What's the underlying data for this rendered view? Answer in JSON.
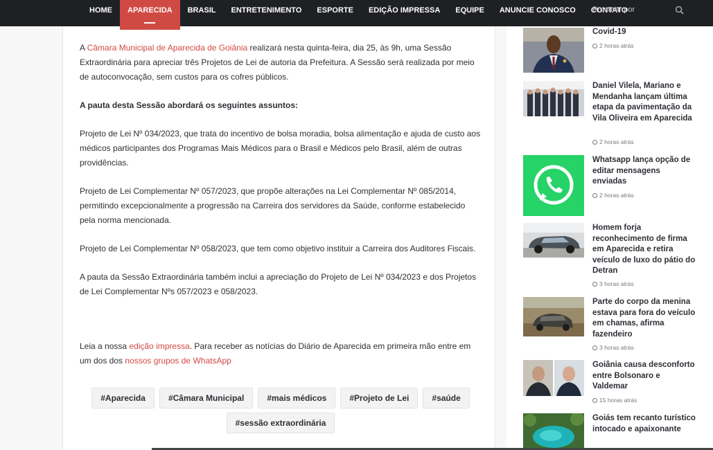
{
  "nav": {
    "items": [
      "HOME",
      "APARECIDA",
      "BRASIL",
      "ENTRETENIMENTO",
      "ESPORTE",
      "EDIÇÃO IMPRESSA",
      "EQUIPE",
      "ANUNCIE CONOSCO",
      "CONTATO"
    ],
    "active": "APARECIDA",
    "search_placeholder": "Procurar por"
  },
  "article": {
    "p1_prefix": "A ",
    "p1_link": "Câmara Municipal de Aparecida de Goiânia",
    "p1_rest": " realizará nesta quinta-feira, dia 25, às 9h, uma Sessão Extraordinária para apreciar três Projetos de Lei de autoria da Prefeitura. A Sessão será realizada por meio de autoconvocação, sem custos para os cofres públicos.",
    "heading": "A pauta desta Sessão abordará os seguintes assuntos:",
    "p2": "Projeto de Lei Nº 034/2023, que trata do incentivo de bolsa moradia, bolsa alimentação e ajuda de custo aos médicos participantes dos Programas Mais Médicos para o Brasil e Médicos pelo Brasil, além de outras providências.",
    "p3": "Projeto de Lei Complementar Nº 057/2023, que propõe alterações na Lei Complementar Nº 085/2014, permitindo excepcionalmente a progressão na Carreira dos servidores da Saúde, conforme estabelecido pela norma mencionada.",
    "p4": "Projeto de Lei Complementar Nº 058/2023, que tem como objetivo instituir a Carreira dos Auditores Fiscais.",
    "p5": "A pauta da Sessão Extraordinária também inclui a apreciação do Projeto de Lei Nº 034/2023 e dos Projetos de Lei Complementar Nºs 057/2023 e 058/2023.",
    "note_prefix": "Leia a nossa ",
    "note_link1": "edição impressa",
    "note_mid": ". Para receber as notícias do Diário de Aparecida em primeira mão entre em um dos dos ",
    "note_link2": "nossos grupos de WhatsApp"
  },
  "tags": [
    "#Aparecida",
    "#Câmara Municipal",
    "#mais médicos",
    "#Projeto de Lei",
    "#saúde",
    "#sessão extraordinária"
  ],
  "sidebar": {
    "items": [
      {
        "title": "Covid-19",
        "time": "2 horas atrás",
        "icon": "clock-icon"
      },
      {
        "title": "Daniel Vilela, Mariano e Mendanha lançam última etapa da pavimentação da Vila Oliveira em Aparecida",
        "time": "2 horas atrás"
      },
      {
        "title": "Whatsapp lança opção de editar mensagens enviadas",
        "time": "2 horas atrás"
      },
      {
        "title": "Homem forja reconhecimento de firma em Aparecida e retira veículo de luxo do pátio do Detran",
        "time": "3 horas atrás"
      },
      {
        "title": "Parte do corpo da menina estava para fora do veículo em chamas, afirma fazendeiro",
        "time": "3 horas atrás"
      },
      {
        "title": "Goiânia causa desconforto entre Bolsonaro e Valdemar",
        "time": "15 horas atrás"
      },
      {
        "title": "Goiás tem recanto turístico intocado e apaixonante",
        "time": ""
      }
    ]
  },
  "colors": {
    "accent": "#d04a44",
    "nav_bg": "#1f2024",
    "whatsapp_green": "#25d366"
  }
}
